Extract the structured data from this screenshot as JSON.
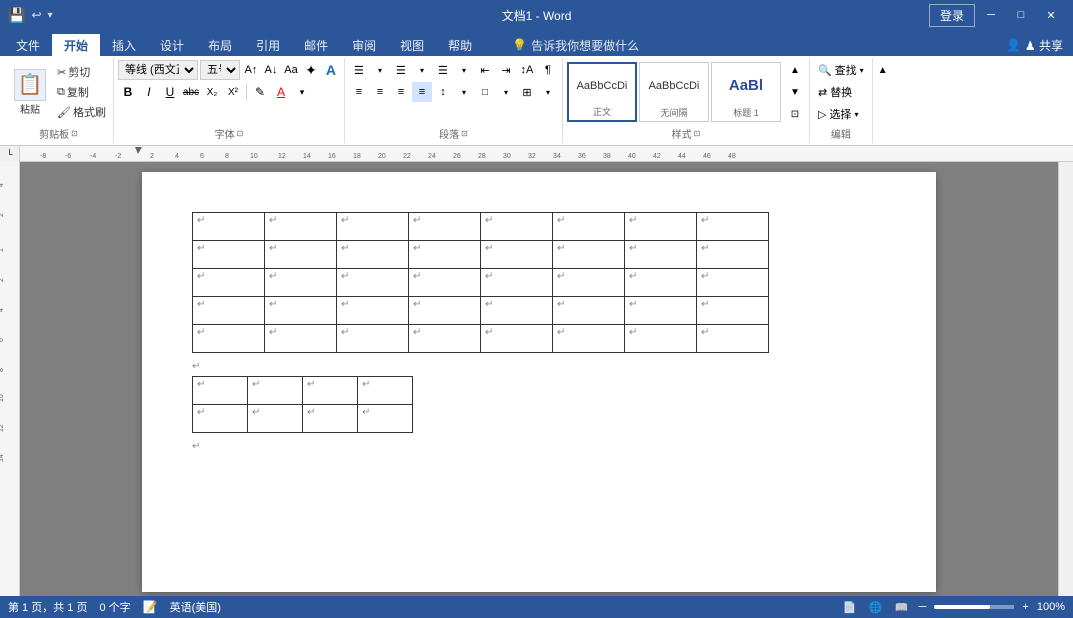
{
  "titleBar": {
    "title": "文档1 - Word",
    "loginBtn": "登录",
    "quickAccess": [
      "💾",
      "↩",
      "▾"
    ]
  },
  "ribbonTabs": {
    "tabs": [
      "文件",
      "开始",
      "插入",
      "设计",
      "布局",
      "引用",
      "邮件",
      "审阅",
      "视图",
      "帮助"
    ],
    "activeTab": "开始",
    "tellMe": "告诉我你想要做什么",
    "share": "♟ 共享"
  },
  "clipboard": {
    "paste": "粘贴",
    "cut": "✂ 剪切",
    "copy": "⧉ 复制",
    "formatPaint": "✎ 格式刷",
    "groupLabel": "剪贴板"
  },
  "font": {
    "fontName": "等线 (西文正)",
    "fontSize": "五号",
    "grow": "A↑",
    "shrink": "A↓",
    "clearFormat": "Aa",
    "fontNameLabel": "等线",
    "bold": "B",
    "italic": "I",
    "underline": "U",
    "strikethrough": "abc",
    "subscript": "X₂",
    "superscript": "X²",
    "fontColor": "A",
    "highlight": "✎",
    "groupLabel": "字体"
  },
  "paragraph": {
    "bullets": "☰",
    "numbering": "☰",
    "multilevel": "☰",
    "decreaseIndent": "⇤",
    "increaseIndent": "⇥",
    "sort": "↕",
    "showMarks": "¶",
    "alignLeft": "≡",
    "alignCenter": "≡",
    "alignRight": "≡",
    "justify": "≡",
    "lineSpacing": "↕",
    "shading": "□",
    "borders": "⊞",
    "groupLabel": "段落"
  },
  "styles": {
    "items": [
      {
        "label": "正文",
        "preview": "AaBbCcDi",
        "active": true
      },
      {
        "label": "无间隔",
        "preview": "AaBbCcDi",
        "active": false
      },
      {
        "label": "标题 1",
        "preview": "AaBl",
        "active": false
      }
    ],
    "groupLabel": "样式"
  },
  "editing": {
    "find": "查找",
    "replace": "替换",
    "select": "选择",
    "groupLabel": "编辑"
  },
  "statusBar": {
    "page": "第 1 页，共 1 页",
    "words": "0 个字",
    "lang": "英语(美国)",
    "zoom": "100%"
  },
  "document": {
    "table1": {
      "rows": 5,
      "cols": 8,
      "cellMark": "↵"
    },
    "table2": {
      "rows": 2,
      "cols": 4,
      "cellMark": "↵"
    }
  }
}
